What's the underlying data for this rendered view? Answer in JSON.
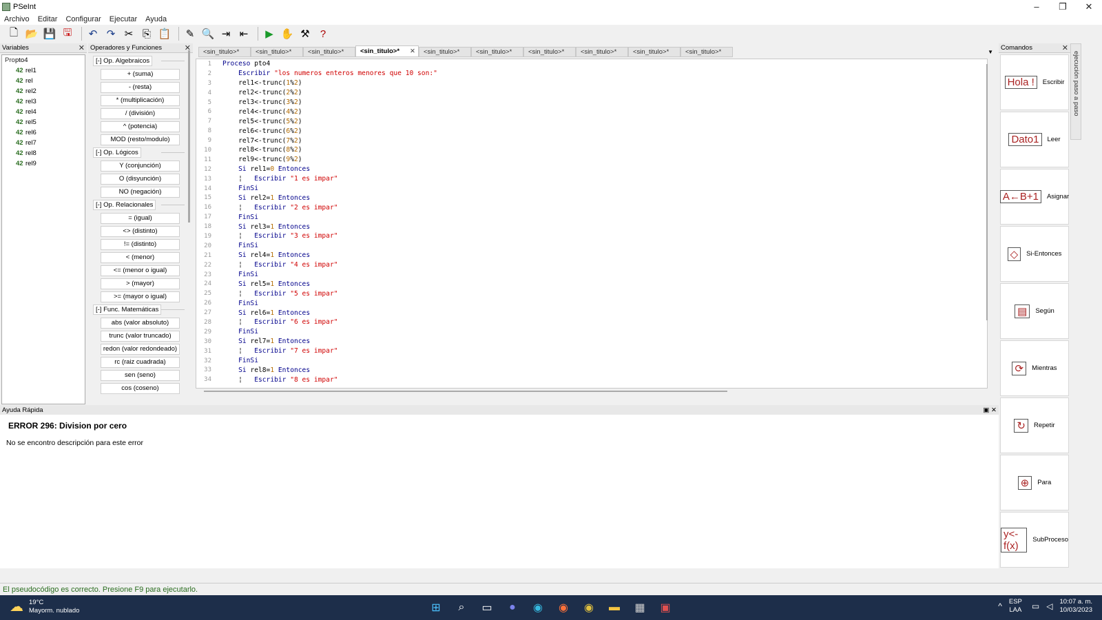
{
  "window": {
    "title": "PSeInt",
    "minimize": "–",
    "maximize": "❐",
    "close": "✕"
  },
  "menu": [
    "Archivo",
    "Editar",
    "Configurar",
    "Ejecutar",
    "Ayuda"
  ],
  "toolbar": {
    "icons": [
      "new-file-icon",
      "open-file-icon",
      "save-icon",
      "save-as-icon",
      "undo-icon",
      "redo-icon",
      "cut-icon",
      "copy-icon",
      "paste-icon",
      "edit-flow-icon",
      "search-icon",
      "indent-icon",
      "outdent-icon",
      "run-icon",
      "step-icon",
      "draw-diagram-icon",
      "help-icon"
    ]
  },
  "variables": {
    "title": "Variables",
    "root": {
      "type": "Pro",
      "name": "pto4"
    },
    "items": [
      {
        "type": "42",
        "name": "rel1"
      },
      {
        "type": "42",
        "name": "rel"
      },
      {
        "type": "42",
        "name": "rel2"
      },
      {
        "type": "42",
        "name": "rel3"
      },
      {
        "type": "42",
        "name": "rel4"
      },
      {
        "type": "42",
        "name": "rel5"
      },
      {
        "type": "42",
        "name": "rel6"
      },
      {
        "type": "42",
        "name": "rel7"
      },
      {
        "type": "42",
        "name": "rel8"
      },
      {
        "type": "42",
        "name": "rel9"
      }
    ]
  },
  "operators": {
    "title": "Operadores y Funciones",
    "groups": [
      {
        "label": "[-]  Op. Algebraicos",
        "items": [
          "+ (suma)",
          "- (resta)",
          "* (multiplicación)",
          "/ (división)",
          "^ (potencia)",
          "MOD (resto/modulo)"
        ]
      },
      {
        "label": "[-]  Op. Lógicos",
        "items": [
          "Y (conjunción)",
          "O (disyunción)",
          "NO (negación)"
        ]
      },
      {
        "label": "[-]  Op. Relacionales",
        "items": [
          "= (igual)",
          "<> (distinto)",
          "!= (distinto)",
          "< (menor)",
          "<= (menor o igual)",
          "> (mayor)",
          ">= (mayor o igual)"
        ]
      },
      {
        "label": "[-]  Func. Matemáticas",
        "items": [
          "abs (valor absoluto)",
          "trunc (valor truncado)",
          "redon (valor redondeado)",
          "rc (raiz cuadrada)",
          "sen (seno)",
          "cos (coseno)"
        ]
      }
    ]
  },
  "tabs": [
    "<sin_titulo>*",
    "<sin_titulo>*",
    "<sin_titulo>*",
    "<sin_titulo>*",
    "<sin_titulo>*",
    "<sin_titulo>*",
    "<sin_titulo>*",
    "<sin_titulo>*",
    "<sin_titulo>*",
    "<sin_titulo>*"
  ],
  "active_tab_index": 3,
  "code": [
    [
      {
        "t": "kw",
        "v": "Proceso "
      },
      {
        "t": "id",
        "v": "pto4"
      }
    ],
    [
      {
        "t": "id",
        "v": "    "
      },
      {
        "t": "kw",
        "v": "Escribir "
      },
      {
        "t": "st",
        "v": "\"los numeros enteros menores que 10 son:\""
      }
    ],
    [
      {
        "t": "id",
        "v": "    rel1<-trunc("
      },
      {
        "t": "nm",
        "v": "1"
      },
      {
        "t": "id",
        "v": "%"
      },
      {
        "t": "nm",
        "v": "2"
      },
      {
        "t": "id",
        "v": ")"
      }
    ],
    [
      {
        "t": "id",
        "v": "    rel2<-trunc("
      },
      {
        "t": "nm",
        "v": "2"
      },
      {
        "t": "id",
        "v": "%"
      },
      {
        "t": "nm",
        "v": "2"
      },
      {
        "t": "id",
        "v": ")"
      }
    ],
    [
      {
        "t": "id",
        "v": "    rel3<-trunc("
      },
      {
        "t": "nm",
        "v": "3"
      },
      {
        "t": "id",
        "v": "%"
      },
      {
        "t": "nm",
        "v": "2"
      },
      {
        "t": "id",
        "v": ")"
      }
    ],
    [
      {
        "t": "id",
        "v": "    rel4<-trunc("
      },
      {
        "t": "nm",
        "v": "4"
      },
      {
        "t": "id",
        "v": "%"
      },
      {
        "t": "nm",
        "v": "2"
      },
      {
        "t": "id",
        "v": ")"
      }
    ],
    [
      {
        "t": "id",
        "v": "    rel5<-trunc("
      },
      {
        "t": "nm",
        "v": "5"
      },
      {
        "t": "id",
        "v": "%"
      },
      {
        "t": "nm",
        "v": "2"
      },
      {
        "t": "id",
        "v": ")"
      }
    ],
    [
      {
        "t": "id",
        "v": "    rel6<-trunc("
      },
      {
        "t": "nm",
        "v": "6"
      },
      {
        "t": "id",
        "v": "%"
      },
      {
        "t": "nm",
        "v": "2"
      },
      {
        "t": "id",
        "v": ")"
      }
    ],
    [
      {
        "t": "id",
        "v": "    rel7<-trunc("
      },
      {
        "t": "nm",
        "v": "7"
      },
      {
        "t": "id",
        "v": "%"
      },
      {
        "t": "nm",
        "v": "2"
      },
      {
        "t": "id",
        "v": ")"
      }
    ],
    [
      {
        "t": "id",
        "v": "    rel8<-trunc("
      },
      {
        "t": "nm",
        "v": "8"
      },
      {
        "t": "id",
        "v": "%"
      },
      {
        "t": "nm",
        "v": "2"
      },
      {
        "t": "id",
        "v": ")"
      }
    ],
    [
      {
        "t": "id",
        "v": "    rel9<-trunc("
      },
      {
        "t": "nm",
        "v": "9"
      },
      {
        "t": "id",
        "v": "%"
      },
      {
        "t": "nm",
        "v": "2"
      },
      {
        "t": "id",
        "v": ")"
      }
    ],
    [
      {
        "t": "id",
        "v": "    "
      },
      {
        "t": "kw",
        "v": "Si "
      },
      {
        "t": "id",
        "v": "rel1="
      },
      {
        "t": "nm",
        "v": "0"
      },
      {
        "t": "kw",
        "v": " Entonces"
      }
    ],
    [
      {
        "t": "id",
        "v": "    ¦   "
      },
      {
        "t": "kw",
        "v": "Escribir "
      },
      {
        "t": "st",
        "v": "\"1 es impar\""
      }
    ],
    [
      {
        "t": "id",
        "v": "    "
      },
      {
        "t": "kw",
        "v": "FinSi"
      }
    ],
    [
      {
        "t": "id",
        "v": "    "
      },
      {
        "t": "kw",
        "v": "Si "
      },
      {
        "t": "id",
        "v": "rel2="
      },
      {
        "t": "nm",
        "v": "1"
      },
      {
        "t": "kw",
        "v": " Entonces"
      }
    ],
    [
      {
        "t": "id",
        "v": "    ¦   "
      },
      {
        "t": "kw",
        "v": "Escribir "
      },
      {
        "t": "st",
        "v": "\"2 es impar\""
      }
    ],
    [
      {
        "t": "id",
        "v": "    "
      },
      {
        "t": "kw",
        "v": "FinSi"
      }
    ],
    [
      {
        "t": "id",
        "v": "    "
      },
      {
        "t": "kw",
        "v": "Si "
      },
      {
        "t": "id",
        "v": "rel3="
      },
      {
        "t": "nm",
        "v": "1"
      },
      {
        "t": "kw",
        "v": " Entonces"
      }
    ],
    [
      {
        "t": "id",
        "v": "    ¦   "
      },
      {
        "t": "kw",
        "v": "Escribir "
      },
      {
        "t": "st",
        "v": "\"3 es impar\""
      }
    ],
    [
      {
        "t": "id",
        "v": "    "
      },
      {
        "t": "kw",
        "v": "FinSi"
      }
    ],
    [
      {
        "t": "id",
        "v": "    "
      },
      {
        "t": "kw",
        "v": "Si "
      },
      {
        "t": "id",
        "v": "rel4="
      },
      {
        "t": "nm",
        "v": "1"
      },
      {
        "t": "kw",
        "v": " Entonces"
      }
    ],
    [
      {
        "t": "id",
        "v": "    ¦   "
      },
      {
        "t": "kw",
        "v": "Escribir "
      },
      {
        "t": "st",
        "v": "\"4 es impar\""
      }
    ],
    [
      {
        "t": "id",
        "v": "    "
      },
      {
        "t": "kw",
        "v": "FinSi"
      }
    ],
    [
      {
        "t": "id",
        "v": "    "
      },
      {
        "t": "kw",
        "v": "Si "
      },
      {
        "t": "id",
        "v": "rel5="
      },
      {
        "t": "nm",
        "v": "1"
      },
      {
        "t": "kw",
        "v": " Entonces"
      }
    ],
    [
      {
        "t": "id",
        "v": "    ¦   "
      },
      {
        "t": "kw",
        "v": "Escribir "
      },
      {
        "t": "st",
        "v": "\"5 es impar\""
      }
    ],
    [
      {
        "t": "id",
        "v": "    "
      },
      {
        "t": "kw",
        "v": "FinSi"
      }
    ],
    [
      {
        "t": "id",
        "v": "    "
      },
      {
        "t": "kw",
        "v": "Si "
      },
      {
        "t": "id",
        "v": "rel6="
      },
      {
        "t": "nm",
        "v": "1"
      },
      {
        "t": "kw",
        "v": " Entonces"
      }
    ],
    [
      {
        "t": "id",
        "v": "    ¦   "
      },
      {
        "t": "kw",
        "v": "Escribir "
      },
      {
        "t": "st",
        "v": "\"6 es impar\""
      }
    ],
    [
      {
        "t": "id",
        "v": "    "
      },
      {
        "t": "kw",
        "v": "FinSi"
      }
    ],
    [
      {
        "t": "id",
        "v": "    "
      },
      {
        "t": "kw",
        "v": "Si "
      },
      {
        "t": "id",
        "v": "rel7="
      },
      {
        "t": "nm",
        "v": "1"
      },
      {
        "t": "kw",
        "v": " Entonces"
      }
    ],
    [
      {
        "t": "id",
        "v": "    ¦   "
      },
      {
        "t": "kw",
        "v": "Escribir "
      },
      {
        "t": "st",
        "v": "\"7 es impar\""
      }
    ],
    [
      {
        "t": "id",
        "v": "    "
      },
      {
        "t": "kw",
        "v": "FinSi"
      }
    ],
    [
      {
        "t": "id",
        "v": "    "
      },
      {
        "t": "kw",
        "v": "Si "
      },
      {
        "t": "id",
        "v": "rel8="
      },
      {
        "t": "nm",
        "v": "1"
      },
      {
        "t": "kw",
        "v": " Entonces"
      }
    ],
    [
      {
        "t": "id",
        "v": "    ¦   "
      },
      {
        "t": "kw",
        "v": "Escribir "
      },
      {
        "t": "st",
        "v": "\"8 es impar\""
      }
    ]
  ],
  "help": {
    "title": "Ayuda Rápida",
    "error_title": "ERROR 296: Division por cero",
    "error_desc": "No se encontro descripción para este error"
  },
  "commands": {
    "title": "Comandos",
    "items": [
      {
        "icon": "Hola !",
        "label": "Escribir"
      },
      {
        "icon": "Dato1",
        "label": "Leer"
      },
      {
        "icon": "A←B+1",
        "label": "Asignar"
      },
      {
        "icon": "◇",
        "label": "Si-Entonces"
      },
      {
        "icon": "▤",
        "label": "Según"
      },
      {
        "icon": "⟳",
        "label": "Mientras"
      },
      {
        "icon": "↻",
        "label": "Repetir"
      },
      {
        "icon": "⊕",
        "label": "Para"
      },
      {
        "icon": "y<-f(x)",
        "label": "SubProceso"
      }
    ]
  },
  "sidetab": "ejecución paso a paso",
  "status": "El pseudocódigo es correcto. Presione F9 para ejecutarlo.",
  "taskbar": {
    "temp": "19°C",
    "weather": "Mayorm. nublado",
    "lang1": "ESP",
    "lang2": "LAA",
    "time": "10:07 a. m.",
    "date": "10/03/2023"
  }
}
